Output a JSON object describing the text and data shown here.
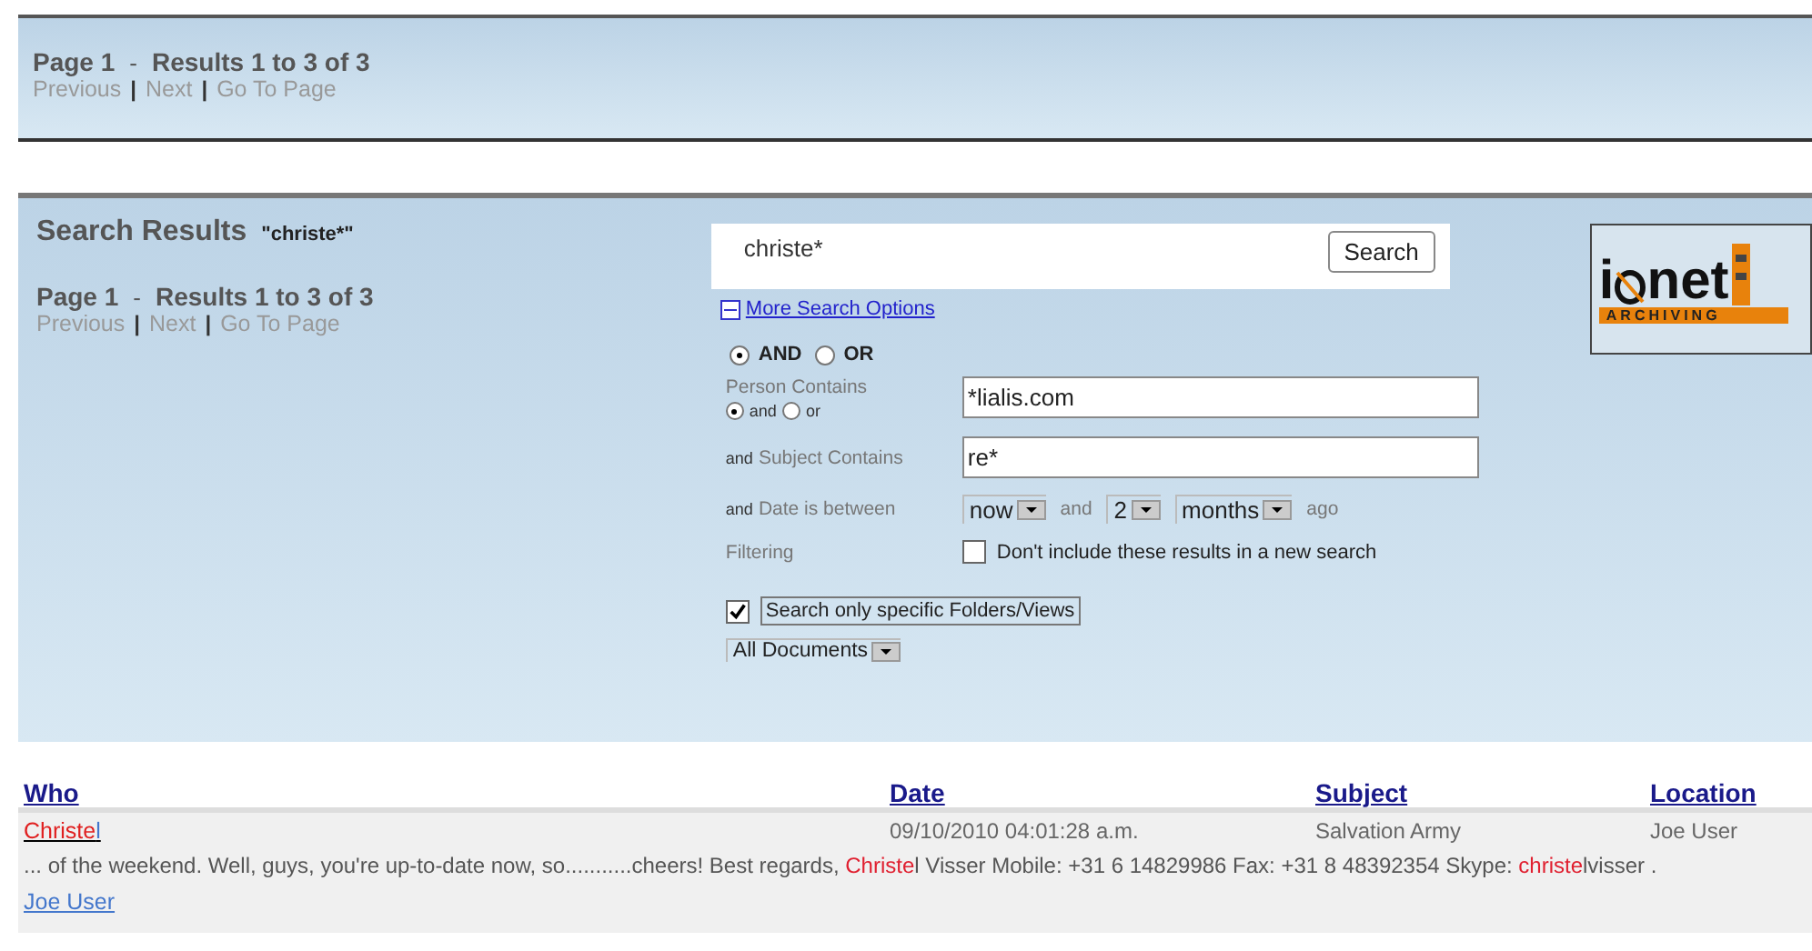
{
  "top_pager": {
    "page": "Page 1",
    "separator": "-",
    "results": "Results 1 to 3 of 3",
    "links": [
      "Previous",
      "Next",
      "Go To Page"
    ],
    "divider": "|"
  },
  "search_panel": {
    "title": "Search Results",
    "query_label": "\"christe*\"",
    "pager": {
      "page": "Page 1",
      "separator": "-",
      "results": "Results 1 to 3 of 3",
      "links": [
        "Previous",
        "Next",
        "Go To Page"
      ],
      "divider": "|"
    },
    "search_field": {
      "value": "christe*"
    },
    "search_button": "Search",
    "more_options": {
      "label": "More Search Options",
      "expanded": true
    },
    "logic": [
      {
        "label": "AND",
        "selected": true
      },
      {
        "label": "OR",
        "selected": false
      }
    ],
    "person": {
      "label": "Person Contains",
      "value": "*lialis.com",
      "logic": [
        {
          "label": "and",
          "selected": true
        },
        {
          "label": "or",
          "selected": false
        }
      ]
    },
    "subject": {
      "prefix": "and",
      "label": "Subject Contains",
      "value": "re*"
    },
    "date": {
      "prefix": "and",
      "label": "Date is between",
      "from": "now",
      "joiner": "and",
      "amount": "2",
      "unit": "months",
      "suffix": "ago"
    },
    "filtering": {
      "label": "Filtering",
      "option": "Don't include these results in a new search",
      "checked": false
    },
    "folders": {
      "label": "Search only specific Folders/Views",
      "checked": true,
      "view": "All Documents"
    },
    "logo": {
      "letter": "i",
      "word": "net",
      "tagline": "ARCHIVING"
    }
  },
  "results": {
    "columns": [
      "Who",
      "Date",
      "Subject",
      "Location"
    ],
    "rows": [
      {
        "who": [
          {
            "text": "Christe",
            "highlight": true
          },
          {
            "text": "l",
            "highlight": false
          }
        ],
        "date": "09/10/2010 04:01:28 a.m.",
        "subject": "Salvation Army",
        "location": "Joe User",
        "snippet": [
          {
            "text": "... of the weekend. Well, guys, you're up-to-date now, so...........cheers! Best regards, ",
            "highlight": false
          },
          {
            "text": "Christe",
            "highlight": true
          },
          {
            "text": "l Visser Mobile: +31 6 14829986 Fax: +31 8 48392354 Skype: ",
            "highlight": false
          },
          {
            "text": "christe",
            "highlight": true
          },
          {
            "text": "lvisser .",
            "highlight": false
          }
        ],
        "author": "Joe User"
      }
    ]
  }
}
